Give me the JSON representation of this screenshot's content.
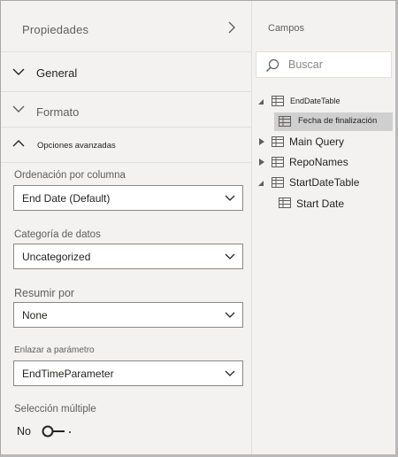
{
  "properties": {
    "title": "Propiedades",
    "sections": {
      "general": "General",
      "formato": "Formato",
      "avanzadas": "Opciones avanzadas"
    },
    "fields": {
      "sort_label": "Ordenación por columna",
      "sort_value": "End Date (Default)",
      "category_label": "Categoría de datos",
      "category_value": "Uncategorized",
      "summarize_label": "Resumir por",
      "summarize_value": "None",
      "bind_label": "Enlazar a parámetro",
      "bind_value": "EndTimeParameter",
      "multi_label": "Selección múltiple",
      "multi_state": "No"
    }
  },
  "fields_pane": {
    "title": "Campos",
    "search_placeholder": "Buscar",
    "tree": [
      {
        "label": "EndDateTable",
        "expanded": true,
        "children": [
          "Fecha de finalización"
        ]
      },
      {
        "label": "Main Query",
        "expanded": false
      },
      {
        "label": "RepoNames",
        "expanded": false
      },
      {
        "label": "StartDateTable",
        "expanded": true,
        "children": [
          "Start Date"
        ]
      }
    ]
  },
  "colors": {
    "pane_bg": "#f3f2f1",
    "border": "#8a8886",
    "selected": "#cfcfcf",
    "text": "#252423"
  }
}
